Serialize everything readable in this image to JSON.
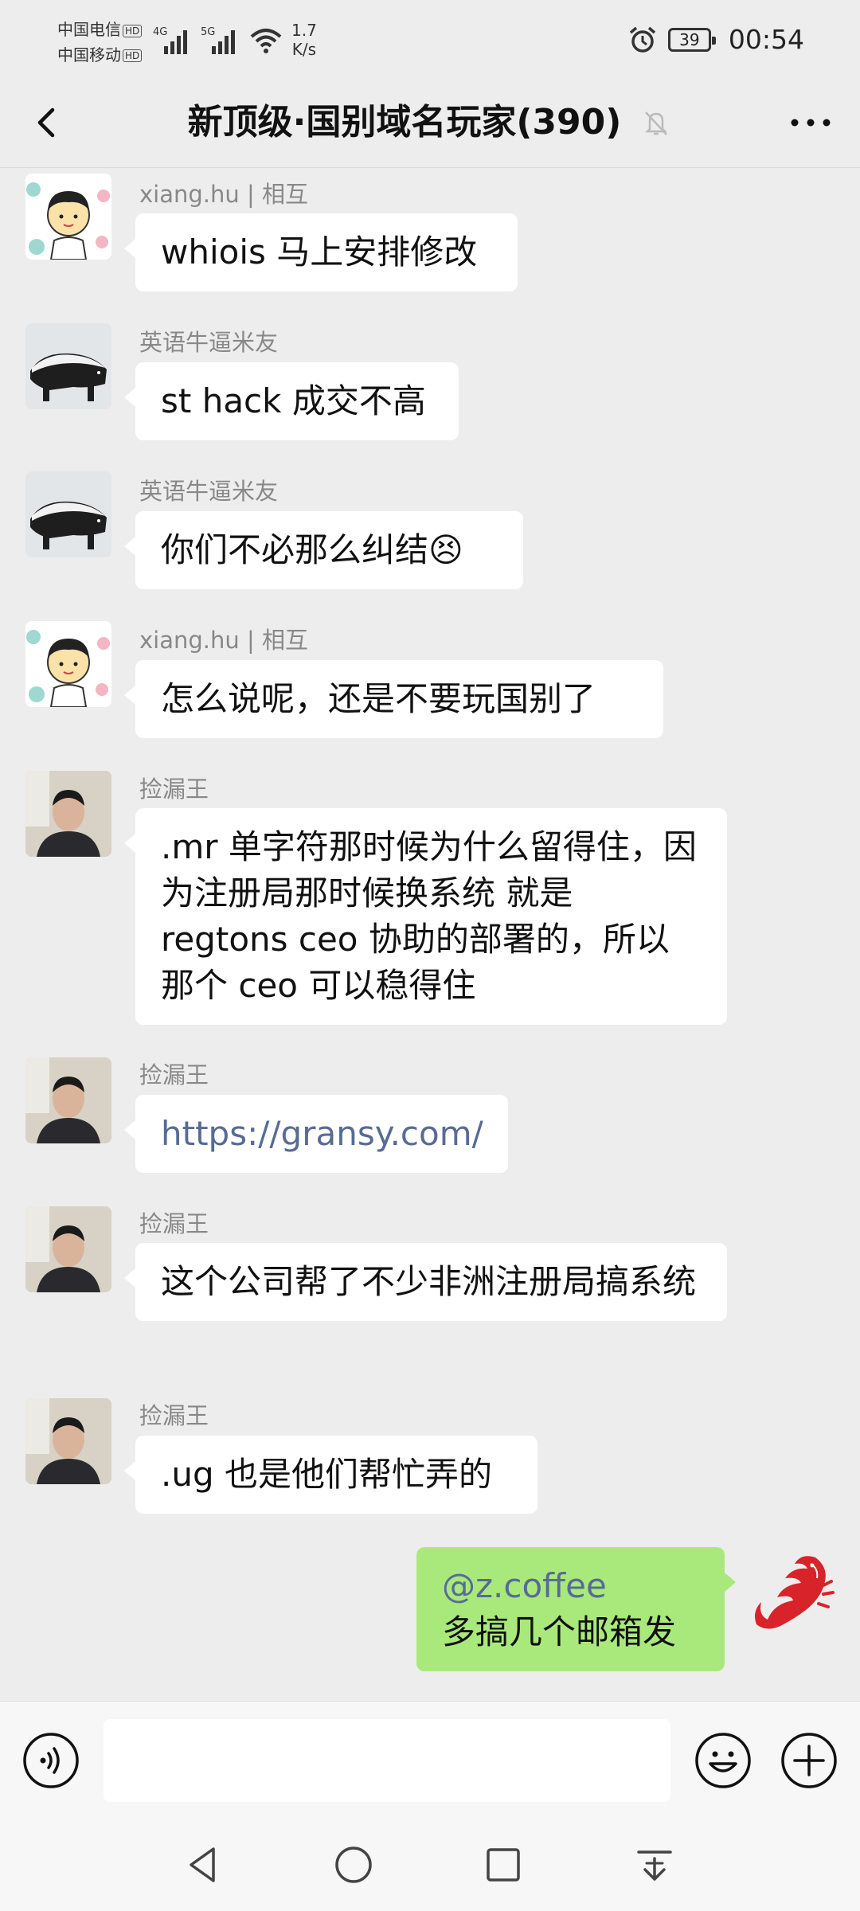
{
  "status_bar": {
    "carrier1": "中国电信",
    "carrier2": "中国移动",
    "hd": "HD",
    "net1": "4G",
    "net2": "5G",
    "speed_value": "1.7",
    "speed_unit": "K/s",
    "battery": "39",
    "time": "00:54"
  },
  "header": {
    "title": "新顶级·国别域名玩家(390)",
    "icons": [
      "back-arrow-icon",
      "mute-bell-icon",
      "more-dots-icon"
    ]
  },
  "messages": [
    {
      "sender": "xiang.hu | 相互",
      "avatar": "cartoon-boy",
      "text": "whiois 马上安排修改"
    },
    {
      "sender": "英语牛逼米友",
      "avatar": "honey-badger",
      "text": "st hack 成交不高"
    },
    {
      "sender": "英语牛逼米友",
      "avatar": "honey-badger",
      "text": "你们不必那么纠结😣"
    },
    {
      "sender": "xiang.hu | 相互",
      "avatar": "cartoon-boy",
      "text": "怎么说呢，还是不要玩国别了"
    },
    {
      "sender": "捡漏王",
      "avatar": "man-photo",
      "text": ".mr 单字符那时候为什么留得住，因为注册局那时候换系统 就是 regtons ceo 协助的部署的，所以那个 ceo 可以稳得住"
    },
    {
      "sender": "捡漏王",
      "avatar": "man-photo",
      "text": "https://gransy.com/"
    },
    {
      "sender": "捡漏王",
      "avatar": "man-photo",
      "text": "这个公司帮了不少非洲注册局搞系统"
    },
    {
      "sender": "捡漏王",
      "avatar": "man-photo",
      "text": ".ug 也是他们帮忙弄的"
    }
  ],
  "my_message": {
    "mention": "@z.coffee",
    "text": "多搞几个邮箱发",
    "avatar": "red-dragon"
  },
  "input_bar": {
    "icons": [
      "voice-icon",
      "emoji-icon",
      "plus-icon"
    ]
  },
  "nav_bar": {
    "icons": [
      "nav-back-icon",
      "nav-home-icon",
      "nav-recents-icon",
      "nav-notification-icon"
    ]
  },
  "colors": {
    "background": "#EDEDED",
    "bubble_other": "#FFFFFF",
    "bubble_me": "#A9E97B",
    "link": "#576B95",
    "sender_name": "#888888"
  }
}
